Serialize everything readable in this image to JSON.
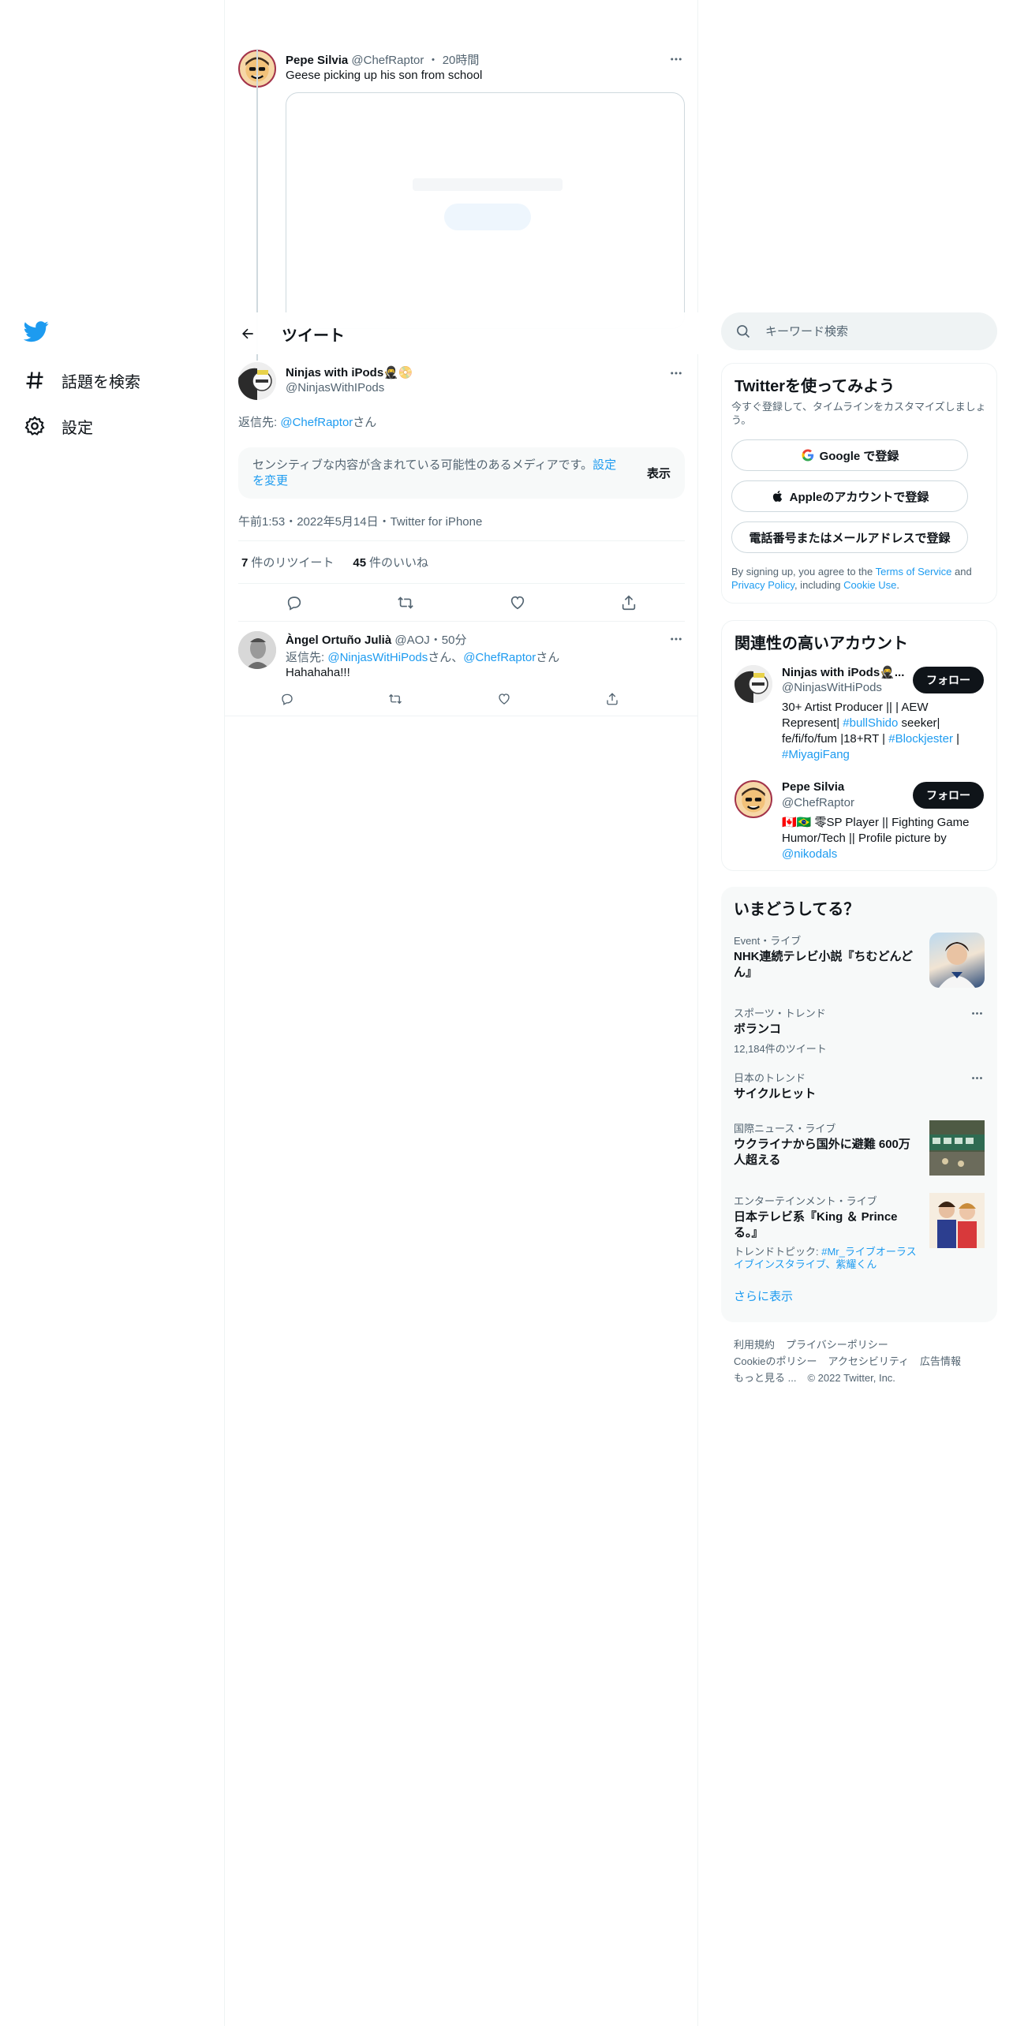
{
  "nav": {
    "logo": "twitter-bird-icon",
    "items": [
      {
        "label": "話題を検索",
        "icon": "hashtag-icon"
      },
      {
        "label": "設定",
        "icon": "gear-icon"
      }
    ]
  },
  "parent_tweet": {
    "name": "Pepe Silvia",
    "handle": "@ChefRaptor",
    "time": "20時間",
    "text": "Geese picking up his son from school"
  },
  "header": {
    "title": "ツイート"
  },
  "focal_tweet": {
    "name": "Ninjas with iPods🥷📀",
    "handle": "@NinjasWithIPods",
    "reply_prefix": "返信先: ",
    "reply_handle": "@ChefRaptor",
    "reply_suffix": "さん",
    "sensitive_text": "センシティブな内容が含まれている可能性のあるメディアです。",
    "sensitive_link": "設定を変更",
    "show_label": "表示",
    "timestamp": "午前1:53・2022年5月14日・Twitter for iPhone",
    "retweets_count": "7",
    "retweets_label": "件のリツイート",
    "likes_count": "45",
    "likes_label": "件のいいね"
  },
  "reply_tweet": {
    "name": "Àngel Ortuño Julià",
    "handle": "@AOJ",
    "time": "50分",
    "reply_prefix": "返信先: ",
    "reply_handle1": "@NinjasWitHiPods",
    "reply_mid": "さん、",
    "reply_handle2": "@ChefRaptor",
    "reply_suffix": "さん",
    "text": "Hahahaha!!!"
  },
  "search": {
    "placeholder": "キーワード検索"
  },
  "signup": {
    "title": "Twitterを使ってみよう",
    "subtitle": "今すぐ登録して、タイムラインをカスタマイズしましょう。",
    "google_label": "Google で登録",
    "apple_label": "Appleのアカウントで登録",
    "phone_label": "電話番号またはメールアドレスで登録",
    "legal_prefix": "By signing up, you agree to the ",
    "tos": "Terms of Service",
    "legal_and": " and ",
    "privacy": "Privacy Policy",
    "legal_including": ", including ",
    "cookie": "Cookie Use",
    "legal_end": "."
  },
  "who_to_follow": {
    "title": "関連性の高いアカウント",
    "follow_label": "フォロー",
    "accounts": [
      {
        "name": "Ninjas with iPods🥷...",
        "handle": "@NinjasWitHiPods",
        "bio_1": "30+ Artist Producer || | AEW Represent| ",
        "bio_tag1": "#bullShido",
        "bio_2": " seeker| fe/fi/fo/fum |18+RT | ",
        "bio_tag2": "#Blockjester",
        "bio_3": " | ",
        "bio_tag3": "#MiyagiFang"
      },
      {
        "name": "Pepe Silvia",
        "handle": "@ChefRaptor",
        "bio_1": "🇨🇦🇧🇷 零SP Player || Fighting Game Humor/Tech || Profile picture by ",
        "bio_tag1": "@nikodals"
      }
    ]
  },
  "trends": {
    "title": "いまどうしてる？",
    "items": [
      {
        "category": "Event・ライブ",
        "title": "NHK連続テレビ小説『ちむどんどん』"
      },
      {
        "category": "スポーツ・トレンド",
        "title": "ボランコ",
        "count": "12,184件のツイート"
      },
      {
        "category": "日本のトレンド",
        "title": "サイクルヒット"
      },
      {
        "category": "国際ニュース・ライブ",
        "title": "ウクライナから国外に避難 600万人超える"
      },
      {
        "category": "エンターテインメント・ライブ",
        "title": "日本テレビ系『King ＆ Prince る。』",
        "topic_prefix": "トレンドトピック: ",
        "topic": "#Mr_ライブオーラスイブインスタライブ、紫耀くん"
      }
    ],
    "show_more": "さらに表示"
  },
  "footer": {
    "links": [
      "利用規約",
      "プライバシーポリシー",
      "Cookieのポリシー",
      "アクセシビリティ",
      "広告情報",
      "もっと見る ..."
    ],
    "copyright": "© 2022 Twitter, Inc."
  }
}
